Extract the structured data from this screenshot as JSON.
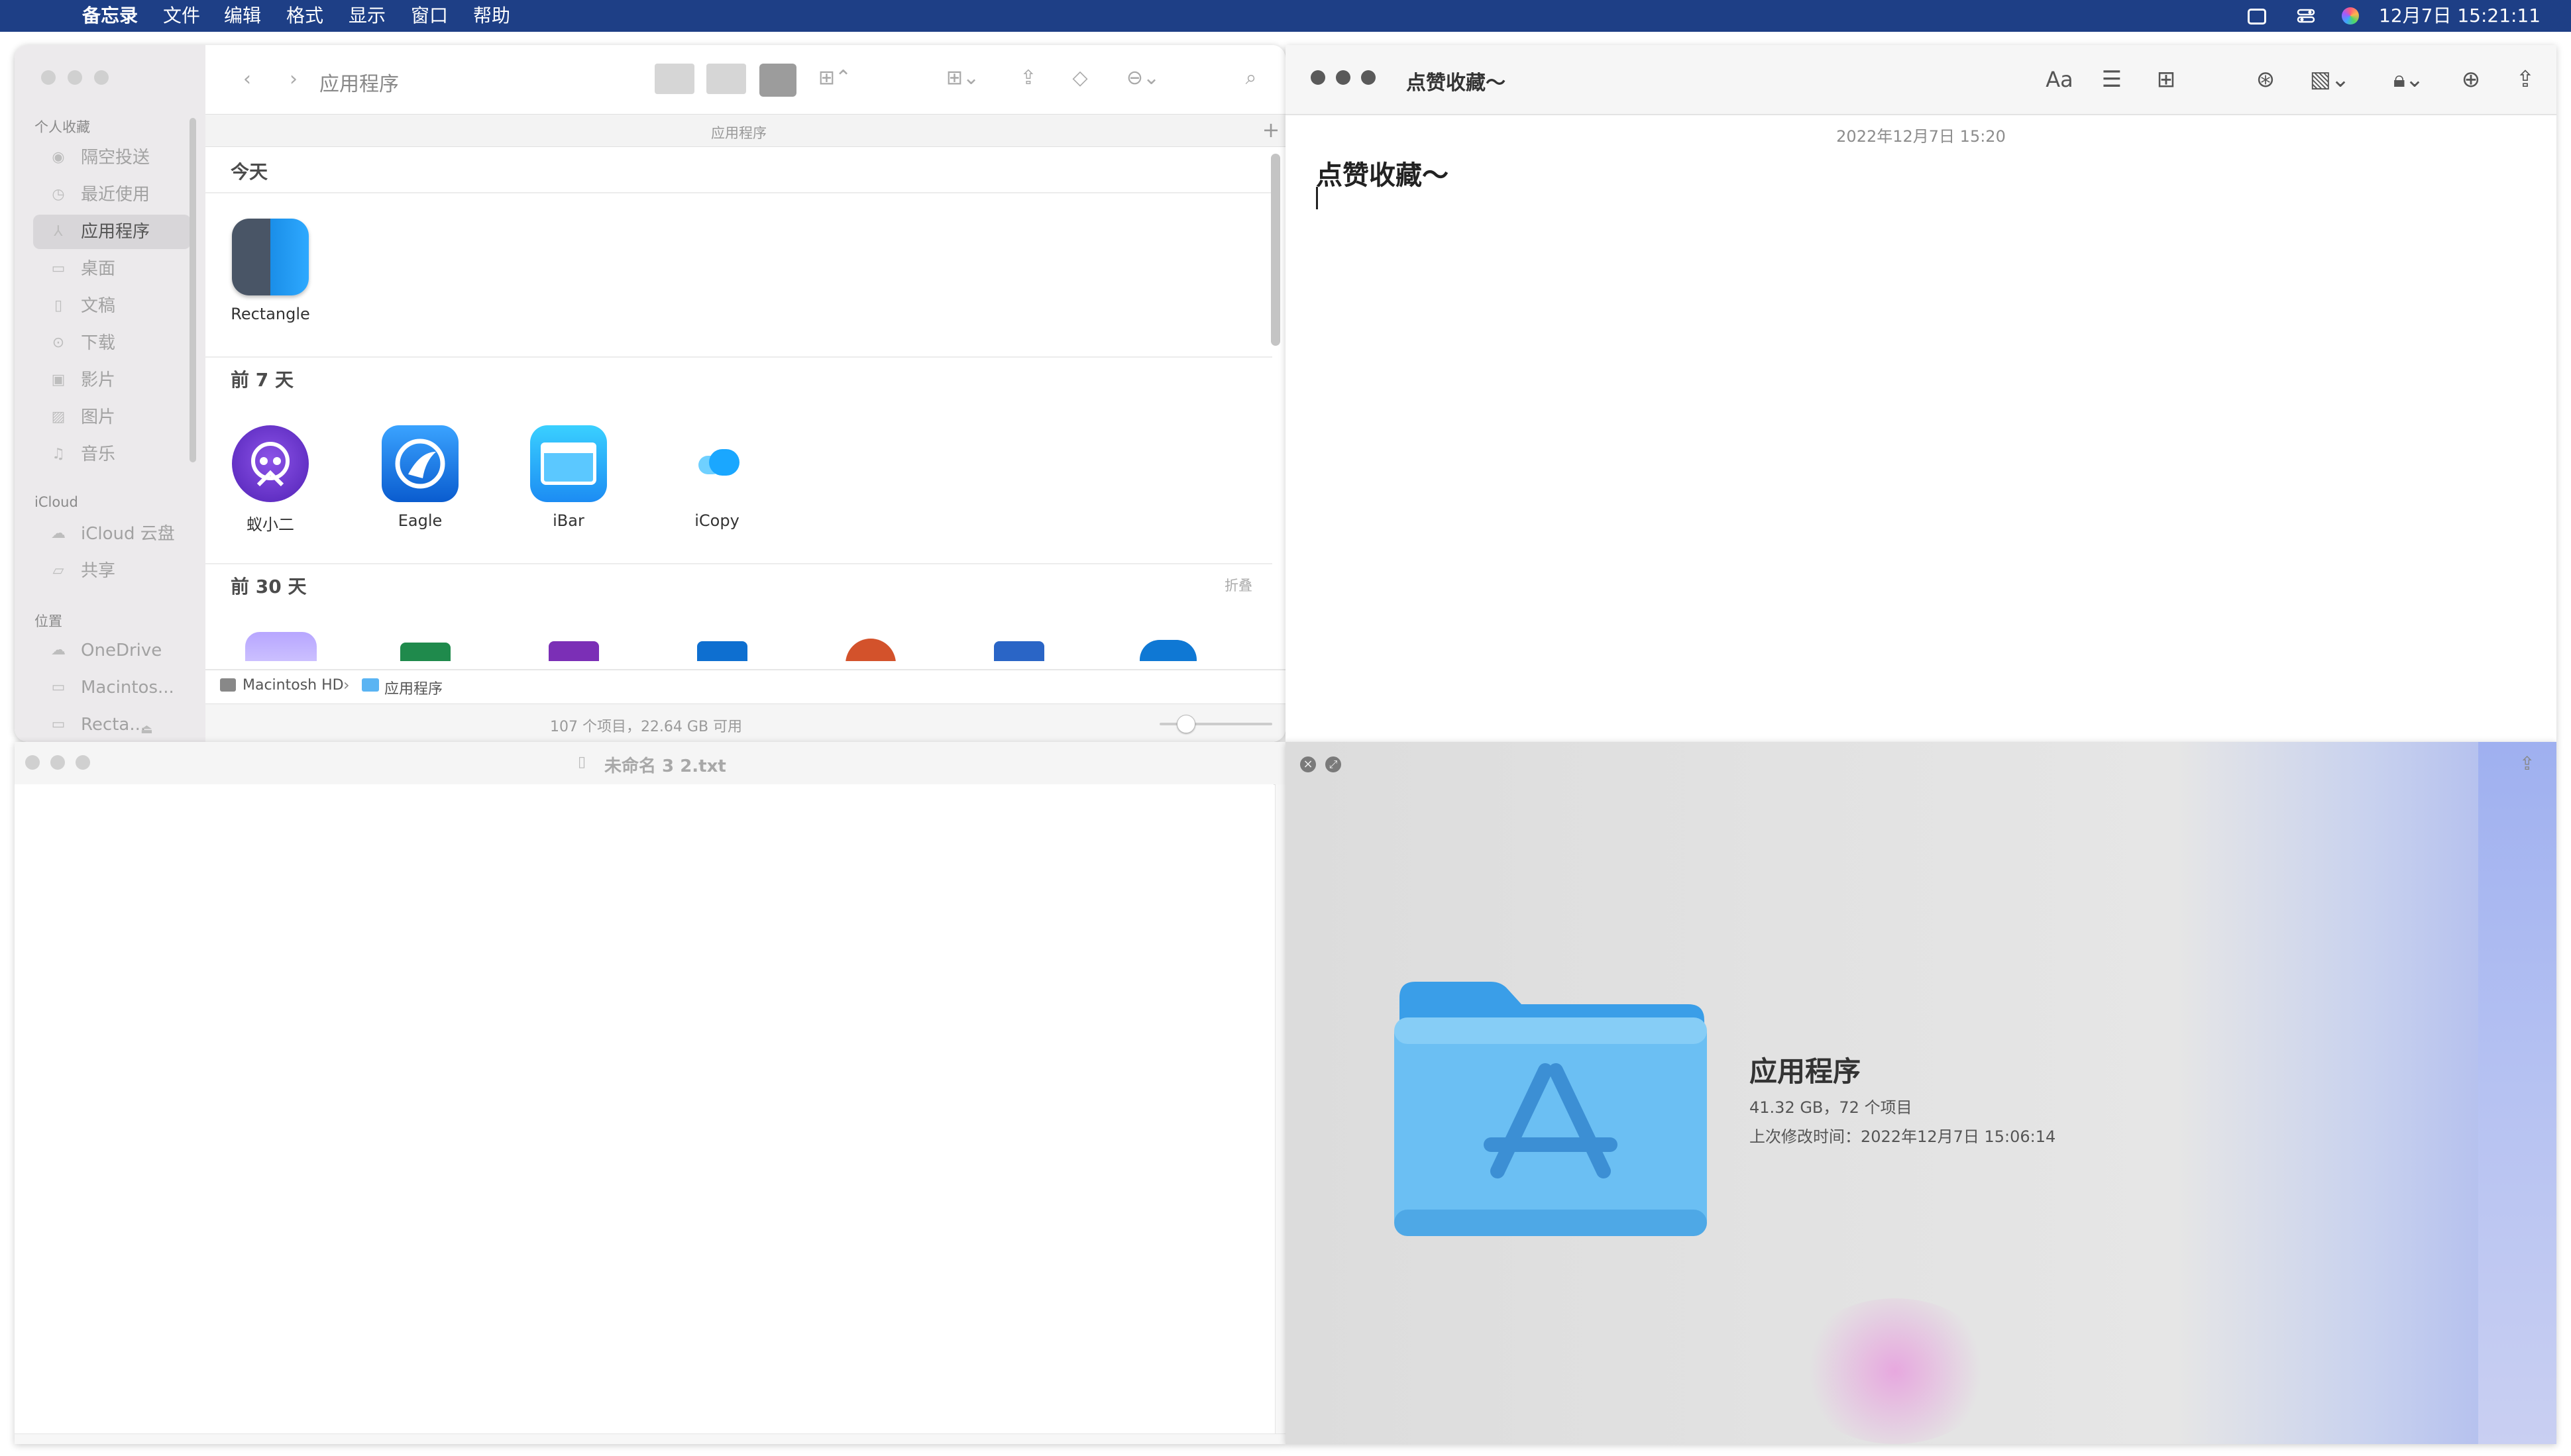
{
  "menubar": {
    "app_name": "备忘录",
    "menus": [
      "文件",
      "编辑",
      "格式",
      "显示",
      "窗口",
      "帮助"
    ],
    "clock": "12月7日  15:21:11"
  },
  "finder": {
    "title": "应用程序",
    "path_header": "应用程序",
    "sidebar": {
      "favorites_header": "个人收藏",
      "favorites": [
        {
          "label": "隔空投送",
          "icon": "airdrop-icon",
          "glyph": "◉"
        },
        {
          "label": "最近使用",
          "icon": "clock-icon",
          "glyph": "◷"
        },
        {
          "label": "应用程序",
          "icon": "applications-icon",
          "glyph": "⅄"
        },
        {
          "label": "桌面",
          "icon": "desktop-icon",
          "glyph": "▭"
        },
        {
          "label": "文稿",
          "icon": "document-icon",
          "glyph": "▯"
        },
        {
          "label": "下载",
          "icon": "download-icon",
          "glyph": "⊙"
        },
        {
          "label": "影片",
          "icon": "movie-icon",
          "glyph": "▣"
        },
        {
          "label": "图片",
          "icon": "picture-icon",
          "glyph": "▨"
        },
        {
          "label": "音乐",
          "icon": "music-icon",
          "glyph": "♫"
        }
      ],
      "icloud_header": "iCloud",
      "icloud": [
        {
          "label": "iCloud 云盘",
          "icon": "cloud-icon",
          "glyph": "☁"
        },
        {
          "label": "共享",
          "icon": "shared-folder-icon",
          "glyph": "▱"
        }
      ],
      "locations_header": "位置",
      "locations": [
        {
          "label": "OneDrive",
          "icon": "cloud-icon",
          "glyph": "☁"
        },
        {
          "label": "Macintos...",
          "icon": "disk-icon",
          "glyph": "▭"
        },
        {
          "label": "Recta...",
          "icon": "disk-icon",
          "glyph": "▭"
        }
      ]
    },
    "sections": [
      {
        "label": "今天"
      },
      {
        "label": "前 7 天"
      },
      {
        "label": "前 30 天",
        "action": "折叠"
      }
    ],
    "apps_today": [
      {
        "name": "Rectangle"
      }
    ],
    "apps_7days": [
      {
        "name": "蚁小二"
      },
      {
        "name": "Eagle"
      },
      {
        "name": "iBar"
      },
      {
        "name": "iCopy"
      }
    ],
    "path_bar": {
      "disk": "Macintosh HD",
      "separator": "›",
      "folder": "应用程序"
    },
    "status": "107 个项目，22.64 GB 可用"
  },
  "notes": {
    "date": "2022年12月7日 15:20",
    "title": "点赞收藏～",
    "window_title": "点赞收藏～",
    "toolbar_format": "Aa"
  },
  "textedit": {
    "title": "未命名 3 2.txt"
  },
  "quicklook": {
    "name": "应用程序",
    "size": "41.32 GB，72 个项目",
    "modified": "上次修改时间：2022年12月7日 15:06:14"
  }
}
